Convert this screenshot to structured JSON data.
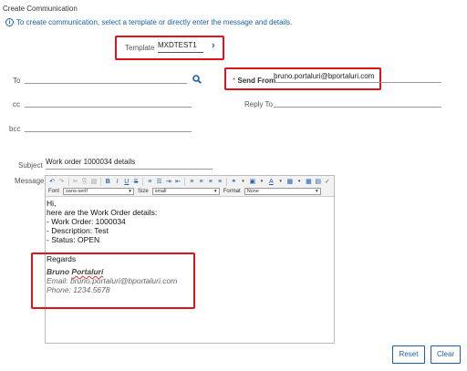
{
  "page": {
    "title": "Create Communication",
    "info": "To create communication, select a template or directly enter the message and details."
  },
  "template": {
    "label": "Template",
    "value": "MXDTEST1"
  },
  "to": {
    "label": "To",
    "value": ""
  },
  "send_from": {
    "required_mark": "*",
    "label": "Send From",
    "value": "bruno.portaluri@bportaluri.com"
  },
  "cc": {
    "label": "cc",
    "value": ""
  },
  "reply_to": {
    "label": "Reply To",
    "value": ""
  },
  "bcc": {
    "label": "bcc",
    "value": ""
  },
  "subject": {
    "label": "Subject",
    "value": "Work order 1000034 details"
  },
  "message": {
    "label": "Message",
    "toolbar": {
      "font_label": "Font",
      "font_value": "sans-serif",
      "size_label": "Size",
      "size_value": "small",
      "format_label": "Format",
      "format_value": "None"
    },
    "body": {
      "greeting": "Hi,",
      "intro": "here are the Work Order details:",
      "line1": "- Work Order: 1000034",
      "line2": "- Description: Test",
      "line3": "- Status: OPEN",
      "regards": "Regards",
      "sig_first": "Bruno",
      "sig_last": "Portaluri",
      "sig_email": "Email: bruno.portaluri@bportaluri.com",
      "sig_phone": "Phone: 1234.5678"
    }
  },
  "buttons": {
    "reset": "Reset",
    "clear": "Clear"
  },
  "colors": {
    "accent": "#1a5fa8",
    "highlight": "#e0121b"
  }
}
